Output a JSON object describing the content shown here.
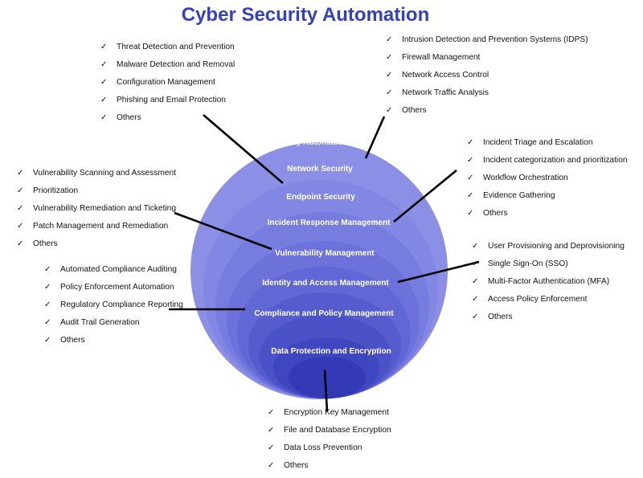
{
  "title": "Cyber Security Automation",
  "layers": [
    "Security Automation",
    "Network Security",
    "Endpoint Security",
    "Incident Response Management",
    "Vulnerability Management",
    "Identity and Access Management",
    "Compliance and Policy Management",
    "Data Protection and Encryption"
  ],
  "colors": {
    "title": "#3440c4",
    "sphere_light": "#8a8fe8",
    "sphere_dark": "#2b30b0",
    "check_icon": "check-icon"
  },
  "lists": {
    "endpoint": [
      "Threat Detection and Prevention",
      "Malware Detection and Removal",
      "Configuration Management",
      "Phishing and Email Protection",
      "Others"
    ],
    "network": [
      "Intrusion Detection and Prevention Systems (IDPS)",
      "Firewall Management",
      "Network Access Control",
      "Network Traffic Analysis",
      "Others"
    ],
    "incident": [
      "Incident Triage and Escalation",
      "Incident categorization and prioritization",
      "Workflow Orchestration",
      "Evidence Gathering",
      "Others"
    ],
    "vulnerability": [
      "Vulnerability Scanning and Assessment",
      "Prioritization",
      "Vulnerability Remediation and Ticketing",
      "Patch Management and Remediation",
      "Others"
    ],
    "identity": [
      "User Provisioning and Deprovisioning",
      "Single Sign-On (SSO)",
      "Multi-Factor Authentication (MFA)",
      "Access Policy Enforcement",
      "Others"
    ],
    "compliance": [
      "Automated Compliance Auditing",
      "Policy Enforcement Automation",
      "Regulatory Compliance Reporting",
      "Audit Trail Generation",
      "Others"
    ],
    "data": [
      "Encryption Key Management",
      "File and Database Encryption",
      "Data Loss Prevention",
      "Others"
    ]
  }
}
